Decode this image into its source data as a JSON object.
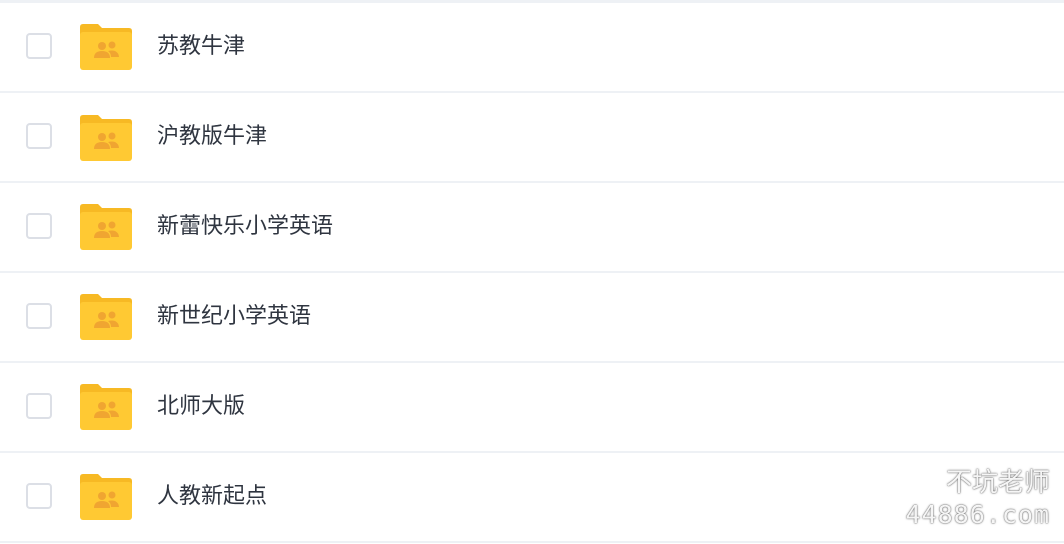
{
  "items": [
    {
      "label": "苏教牛津",
      "checked": false,
      "icon": "shared-folder-icon"
    },
    {
      "label": "沪教版牛津",
      "checked": false,
      "icon": "shared-folder-icon"
    },
    {
      "label": "新蕾快乐小学英语",
      "checked": false,
      "icon": "shared-folder-icon"
    },
    {
      "label": "新世纪小学英语",
      "checked": false,
      "icon": "shared-folder-icon"
    },
    {
      "label": "北师大版",
      "checked": false,
      "icon": "shared-folder-icon"
    },
    {
      "label": "人教新起点",
      "checked": false,
      "icon": "shared-folder-icon"
    }
  ],
  "watermark": {
    "line1": "不坑老师",
    "line2": "44886.com",
    "icon": "wechat-icon"
  },
  "colors": {
    "folder": "#ffc933",
    "folder_tab": "#f7b924",
    "people": "#f0a531",
    "text": "#2f3540",
    "divider": "#eef1f5",
    "checkbox_border": "#dcdfe6"
  }
}
